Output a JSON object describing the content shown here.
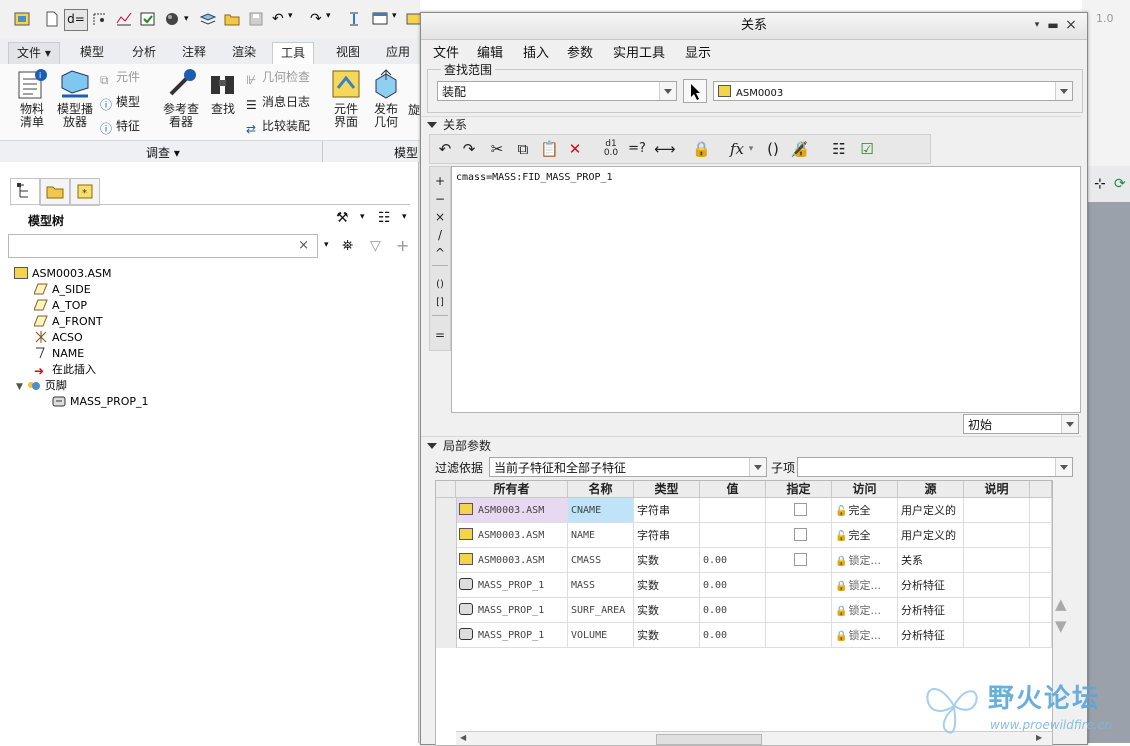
{
  "app": {
    "version_label": "1.0",
    "ribbon_tabs": [
      "文件",
      "模型",
      "分析",
      "注释",
      "渲染",
      "工具",
      "视图",
      "应用程"
    ],
    "ribbon_active_tab": "工具",
    "ribbon": {
      "bom_label_1": "物料",
      "bom_label_2": "清单",
      "player_label_1": "模型播",
      "player_label_2": "放器",
      "component_label": "元件",
      "model_label": "模型",
      "feature_label": "特征",
      "ref_viewer_label_1": "参考查",
      "ref_viewer_label_2": "看器",
      "find_label": "查找",
      "geom_check_label": "几何检查",
      "msg_log_label": "消息日志",
      "compare_asm_label": "比较装配",
      "comp_interface_label_1": "元件",
      "comp_interface_label_2": "界面",
      "publish_geom_label_1": "发布",
      "publish_geom_label_2": "几何",
      "extra_label": "旋",
      "group_investigate": "调查 ▾",
      "group_model": "模型"
    }
  },
  "model_tree": {
    "title": "模型树",
    "search_placeholder": "",
    "items": [
      {
        "label": "ASM0003.ASM",
        "icon": "assembly-icon"
      },
      {
        "label": "A_SIDE",
        "icon": "datum-plane-icon"
      },
      {
        "label": "A_TOP",
        "icon": "datum-plane-icon"
      },
      {
        "label": "A_FRONT",
        "icon": "datum-plane-icon"
      },
      {
        "label": "ACSO",
        "icon": "coordinate-system-icon"
      },
      {
        "label": "NAME",
        "icon": "annotation-icon"
      },
      {
        "label": "在此插入",
        "icon": "insert-here-arrow-icon"
      },
      {
        "label": "页脚",
        "icon": "footer-icon"
      },
      {
        "label": "MASS_PROP_1",
        "icon": "mass-prop-icon"
      }
    ]
  },
  "dialog": {
    "title": "关系",
    "menu": [
      "文件",
      "编辑",
      "插入",
      "参数",
      "实用工具",
      "显示"
    ],
    "scope": {
      "label": "查找范围",
      "type_value": "装配",
      "model_value": "ASM0003"
    },
    "relations": {
      "label": "关系",
      "side_ops": [
        "+",
        "−",
        "×",
        "/",
        "^",
        "()",
        "[]",
        "="
      ],
      "editor_text": "cmass=MASS:FID_MASS_PROP_1",
      "state_value": "初始"
    },
    "local_params": {
      "label": "局部参数",
      "filter_label": "过滤依据",
      "filter_value": "当前子特征和全部子特征",
      "child_label": "子项",
      "child_value": "",
      "columns": [
        "所有者",
        "名称",
        "类型",
        "值",
        "指定",
        "访问",
        "源",
        "说明"
      ],
      "rows": [
        {
          "owner": "ASM0003.ASM",
          "name": "CNAME",
          "type": "字符串",
          "value": "",
          "access": "完全",
          "source": "用户定义的"
        },
        {
          "owner": "ASM0003.ASM",
          "name": "NAME",
          "type": "字符串",
          "value": "",
          "access": "完全",
          "source": "用户定义的"
        },
        {
          "owner": "ASM0003.ASM",
          "name": "CMASS",
          "type": "实数",
          "value": "0.00",
          "access": "锁定...",
          "source": "关系"
        },
        {
          "owner": "MASS_PROP_1",
          "name": "MASS",
          "type": "实数",
          "value": "0.00",
          "access": "锁定...",
          "source": "分析特征"
        },
        {
          "owner": "MASS_PROP_1",
          "name": "SURF_AREA",
          "type": "实数",
          "value": "0.00",
          "access": "锁定...",
          "source": "分析特征"
        },
        {
          "owner": "MASS_PROP_1",
          "name": "VOLUME",
          "type": "实数",
          "value": "0.00",
          "access": "锁定...",
          "source": "分析特征"
        }
      ]
    }
  },
  "watermark": {
    "title": "野火论坛",
    "url": "www.proewildfire.cn"
  },
  "colors": {
    "selected_cell": "#bfe3f8",
    "selected_owner": "#e7d9f2",
    "watermark": "#5aa7d8"
  }
}
